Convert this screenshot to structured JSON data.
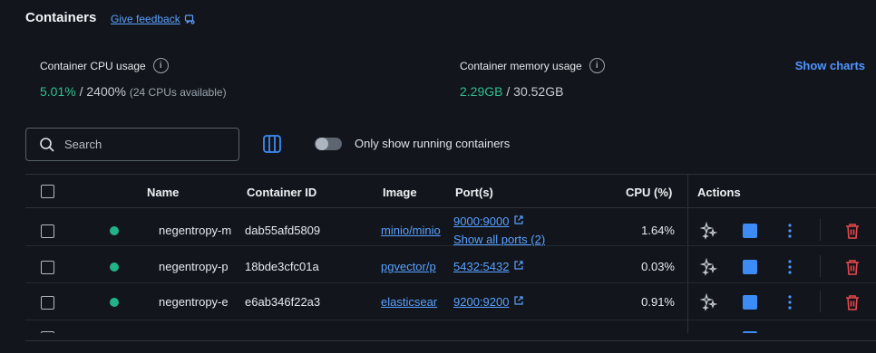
{
  "header": {
    "title": "Containers",
    "feedback_label": "Give feedback"
  },
  "stats": {
    "cpu_label": "Container CPU usage",
    "cpu_used": "5.01%",
    "cpu_sep": " / ",
    "cpu_total": "2400%",
    "cpu_note": "(24 CPUs available)",
    "mem_label": "Container memory usage",
    "mem_used": "2.29GB",
    "mem_sep": " / ",
    "mem_total": "30.52GB",
    "show_charts": "Show charts"
  },
  "toolbar": {
    "search_placeholder": "Search",
    "toggle_label": "Only show running containers"
  },
  "table": {
    "headers": {
      "name": "Name",
      "container_id": "Container ID",
      "image": "Image",
      "ports": "Port(s)",
      "cpu": "CPU (%)",
      "actions": "Actions"
    },
    "rows": [
      {
        "name": "negentropy-m",
        "id": "dab55afd5809",
        "image": "minio/minio",
        "port": "9000:9000",
        "extra": "Show all ports (2)",
        "cpu": "1.64%"
      },
      {
        "name": "negentropy-p",
        "id": "18bde3cfc01a",
        "image": "pgvector/p",
        "port": "5432:5432",
        "extra": "",
        "cpu": "0.03%"
      },
      {
        "name": "negentropy-e",
        "id": "e6ab346f22a3",
        "image": "elasticsear",
        "port": "9200:9200",
        "extra": "",
        "cpu": "0.91%"
      }
    ]
  }
}
